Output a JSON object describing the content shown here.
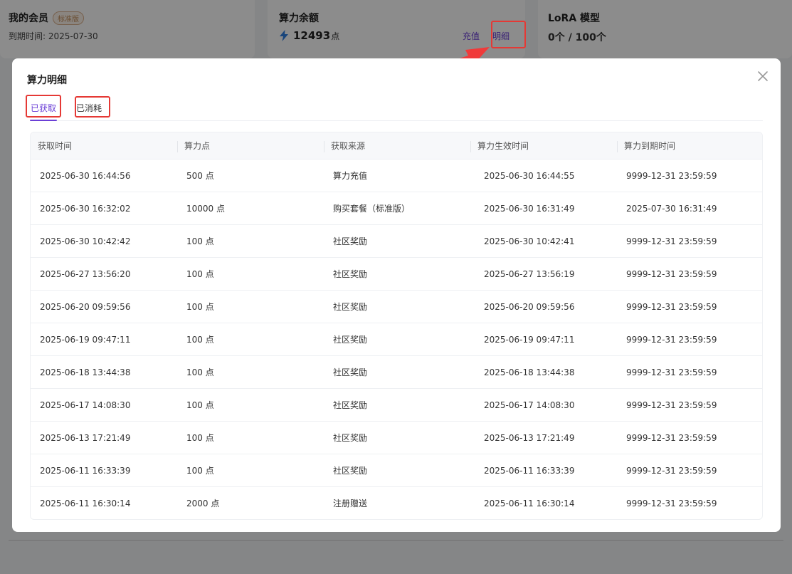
{
  "member_card": {
    "title": "我的会员",
    "badge": "标准版",
    "expire": "到期时间: 2025-07-30"
  },
  "power_card": {
    "title": "算力余额",
    "value": "12493",
    "unit": "点",
    "recharge_label": "充值",
    "detail_label": "明细"
  },
  "lora_card": {
    "title": "LoRA 模型",
    "value": "0个 / 100个"
  },
  "modal": {
    "title": "算力明细",
    "tabs": [
      {
        "label": "已获取"
      },
      {
        "label": "已消耗"
      }
    ],
    "columns": [
      "获取时间",
      "算力点",
      "获取来源",
      "算力生效时间",
      "算力到期时间"
    ],
    "rows": [
      [
        "2025-06-30 16:44:56",
        "500 点",
        "算力充值",
        "2025-06-30 16:44:55",
        "9999-12-31 23:59:59"
      ],
      [
        "2025-06-30 16:32:02",
        "10000 点",
        "购买套餐（标准版）",
        "2025-06-30 16:31:49",
        "2025-07-30 16:31:49"
      ],
      [
        "2025-06-30 10:42:42",
        "100 点",
        "社区奖励",
        "2025-06-30 10:42:41",
        "9999-12-31 23:59:59"
      ],
      [
        "2025-06-27 13:56:20",
        "100 点",
        "社区奖励",
        "2025-06-27 13:56:19",
        "9999-12-31 23:59:59"
      ],
      [
        "2025-06-20 09:59:56",
        "100 点",
        "社区奖励",
        "2025-06-20 09:59:56",
        "9999-12-31 23:59:59"
      ],
      [
        "2025-06-19 09:47:11",
        "100 点",
        "社区奖励",
        "2025-06-19 09:47:11",
        "9999-12-31 23:59:59"
      ],
      [
        "2025-06-18 13:44:38",
        "100 点",
        "社区奖励",
        "2025-06-18 13:44:38",
        "9999-12-31 23:59:59"
      ],
      [
        "2025-06-17 14:08:30",
        "100 点",
        "社区奖励",
        "2025-06-17 14:08:30",
        "9999-12-31 23:59:59"
      ],
      [
        "2025-06-13 17:21:49",
        "100 点",
        "社区奖励",
        "2025-06-13 17:21:49",
        "9999-12-31 23:59:59"
      ],
      [
        "2025-06-11 16:33:39",
        "100 点",
        "社区奖励",
        "2025-06-11 16:33:39",
        "9999-12-31 23:59:59"
      ],
      [
        "2025-06-11 16:30:14",
        "2000 点",
        "注册赠送",
        "2025-06-11 16:30:14",
        "9999-12-31 23:59:59"
      ]
    ]
  },
  "colors": {
    "accent": "#6b3fd6",
    "annotation": "#e53935",
    "bolt": "#2f7fe0"
  },
  "icons": {
    "bolt": "lightning-icon",
    "close": "close-icon"
  }
}
